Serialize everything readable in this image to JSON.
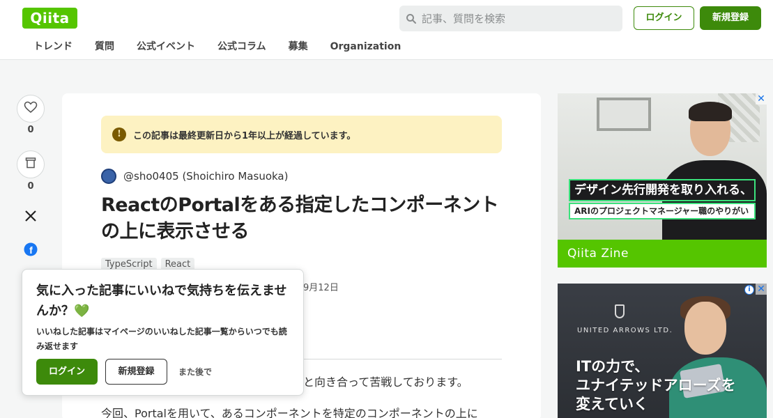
{
  "header": {
    "logo": "Qiita",
    "search_placeholder": "記事、質問を検索",
    "login": "ログイン",
    "signup": "新規登録",
    "nav": [
      "トレンド",
      "質問",
      "公式イベント",
      "公式コラム",
      "募集",
      "Organization"
    ]
  },
  "sidebar": {
    "like_count": "0",
    "stock_count": "0",
    "share_x": "X",
    "share_facebook": "f"
  },
  "article": {
    "notice": "この記事は最終更新日から1年以上が経過しています。",
    "notice_icon": "!",
    "author": "@sho0405 (Shoichiro Masuoka)",
    "title": "ReactのPortalをある指定したコンポーネントの上に表示させる",
    "tags": [
      "TypeScript",
      "React"
    ],
    "date": "9月12日",
    "body_line1": "と向き合って苦戦しております。",
    "body_line2": "今回、Portalを用いて、あるコンポーネントを特定のコンポーネントの上に"
  },
  "popup": {
    "title": "気に入った記事にいいねで気持ちを伝えませんか？",
    "heart": "💚",
    "text": "いいねした記事はマイページのいいねした記事一覧からいつでも読み返せます",
    "login": "ログイン",
    "signup": "新規登録",
    "later": "また後で"
  },
  "ads": {
    "ad1_headline": "デザイン先行開発を取り入れる、",
    "ad1_subline": "ARIのプロジェクトマネージャー職のやりがい",
    "ad1_brand": "Qiita Zine",
    "ad2_logo": "UNITED ARROWS LTD.",
    "ad2_copy_line1": "ITの力で、",
    "ad2_copy_line2": "ユナイテッドアローズを",
    "ad2_copy_line3": "変えていく",
    "close": "✕",
    "info": "i"
  },
  "colors": {
    "brand_green": "#55c500",
    "button_green": "#3d8a0b",
    "notice_bg": "#fdf2c2",
    "page_bg": "#f5f6f6"
  },
  "icons": [
    "search-icon",
    "heart-icon",
    "stock-icon",
    "x-logo-icon",
    "facebook-icon",
    "info-icon",
    "adchoices-icon"
  ]
}
